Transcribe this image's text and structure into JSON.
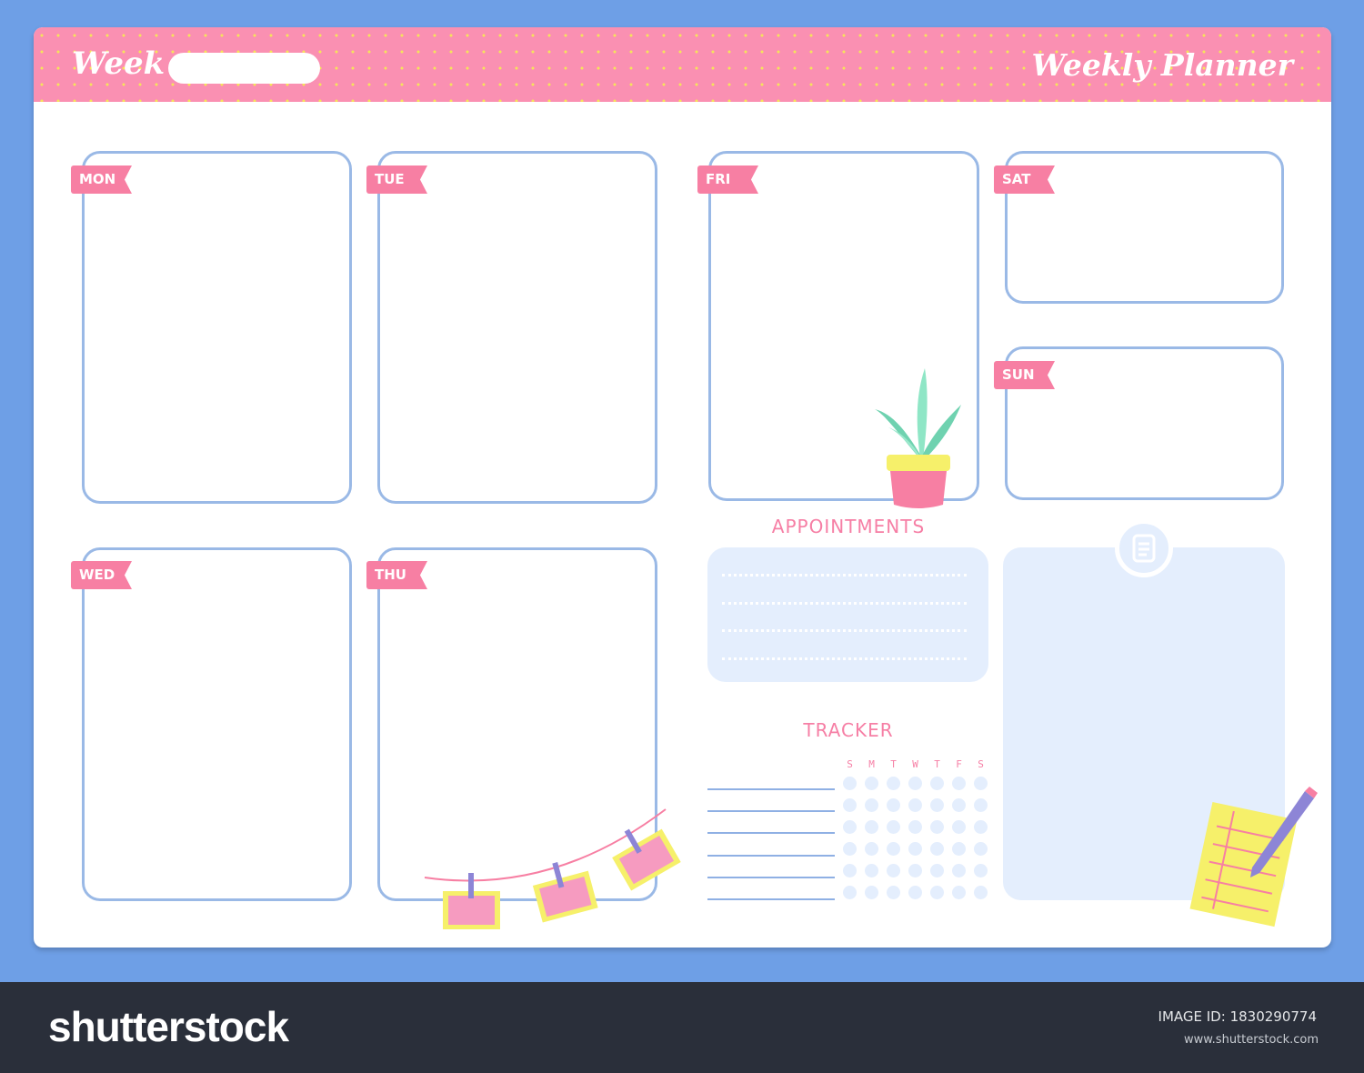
{
  "header": {
    "week_label": "Week",
    "week_value": "",
    "title": "Weekly Planner"
  },
  "days": [
    {
      "label": "MON"
    },
    {
      "label": "TUE"
    },
    {
      "label": "FRI"
    },
    {
      "label": "SAT"
    },
    {
      "label": "SUN"
    },
    {
      "label": "WED"
    },
    {
      "label": "THU"
    }
  ],
  "appointments": {
    "title": "APPOINTMENTS"
  },
  "tracker": {
    "title": "TRACKER",
    "weekdays": [
      "S",
      "M",
      "T",
      "W",
      "T",
      "F",
      "S"
    ]
  },
  "footer": {
    "logo": "shutterstock",
    "image_id_label": "IMAGE ID:",
    "image_id": "1830290774",
    "url": "www.shutterstock.com"
  },
  "colors": {
    "background": "#6e9fe6",
    "header": "#fa90b2",
    "accent_pink": "#f77fa3",
    "box_border": "#9ab9e6",
    "panel": "#e4eefd"
  }
}
